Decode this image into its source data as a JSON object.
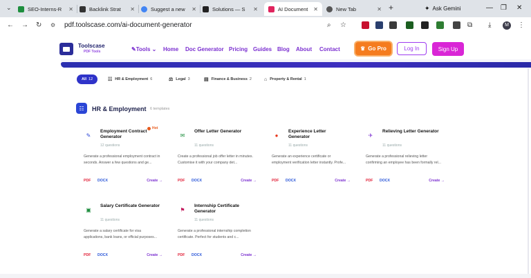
{
  "browser": {
    "tabs": [
      {
        "label": "SEO-Interns-R",
        "color": "#1e8e3e"
      },
      {
        "label": "Backlink Strat",
        "color": "#333333"
      },
      {
        "label": "Suggest a new",
        "color": "#4285f4"
      },
      {
        "label": "Solutions — S",
        "color": "#222222"
      },
      {
        "label": "AI Document",
        "color": "#e0245e",
        "active": true
      },
      {
        "label": "New Tab",
        "color": "#555555"
      }
    ],
    "new_tab_symbol": "+",
    "ask_label": "Ask Gemini",
    "url": "pdf.toolscase.com/ai-document-generator",
    "profile_initial": "M"
  },
  "site": {
    "logo_title": "Toolscase",
    "logo_sub": "PDF Tools",
    "menu": [
      "Tools",
      "Home",
      "Doc Generator",
      "Pricing",
      "Guides",
      "Blog",
      "About",
      "Contact"
    ],
    "go_pro": "Go Pro",
    "login": "Log In",
    "signup": "Sign Up"
  },
  "filters": [
    {
      "label": "All",
      "count": "12",
      "active": true
    },
    {
      "label": "HR & Employment",
      "count": "6",
      "icon": "people-icon"
    },
    {
      "label": "Legal",
      "count": "3",
      "icon": "scale-icon"
    },
    {
      "label": "Finance & Business",
      "count": "2",
      "icon": "chart-icon"
    },
    {
      "label": "Property & Rental",
      "count": "1",
      "icon": "house-icon"
    }
  ],
  "section": {
    "title": "HR & Employment",
    "count": "6 templates"
  },
  "cards": [
    {
      "title": "Employment Contract Generator",
      "questions": "12 questions",
      "desc": "Generate a professional employment contract in seconds. Answer a few questions and ge...",
      "hot": "Hot",
      "icon_color": "#2b46d6",
      "icon": "✎"
    },
    {
      "title": "Offer Letter Generator",
      "questions": "11 questions",
      "desc": "Create a professional job offer letter in minutes. Customise it with your company det...",
      "icon_color": "#1e8e3e",
      "icon": "✉"
    },
    {
      "title": "Experience Letter Generator",
      "questions": "11 questions",
      "desc": "Generate an experience certificate or employment verification letter instantly. Profe...",
      "icon_color": "#e8371c",
      "icon": "●"
    },
    {
      "title": "Relieving Letter Generator",
      "questions": "11 questions",
      "desc": "Generate a professional relieving letter confirming an employee has been formally rel...",
      "icon_color": "#7b2fd0",
      "icon": "✈"
    },
    {
      "title": "Salary Certificate Generator",
      "questions": "11 questions",
      "desc": "Generate a salary certificate for visa applications, bank loans, or official purposes...",
      "icon_color": "#1e8e3e",
      "icon": "▣"
    },
    {
      "title": "Internship Certificate Generator",
      "questions": "11 questions",
      "desc": "Generate a professional internship completion certificate. Perfect for students and c...",
      "icon_color": "#c2185b",
      "icon": "⚑"
    }
  ],
  "card_actions": {
    "pdf": "PDF",
    "docx": "DOCX",
    "create": "Create →"
  }
}
